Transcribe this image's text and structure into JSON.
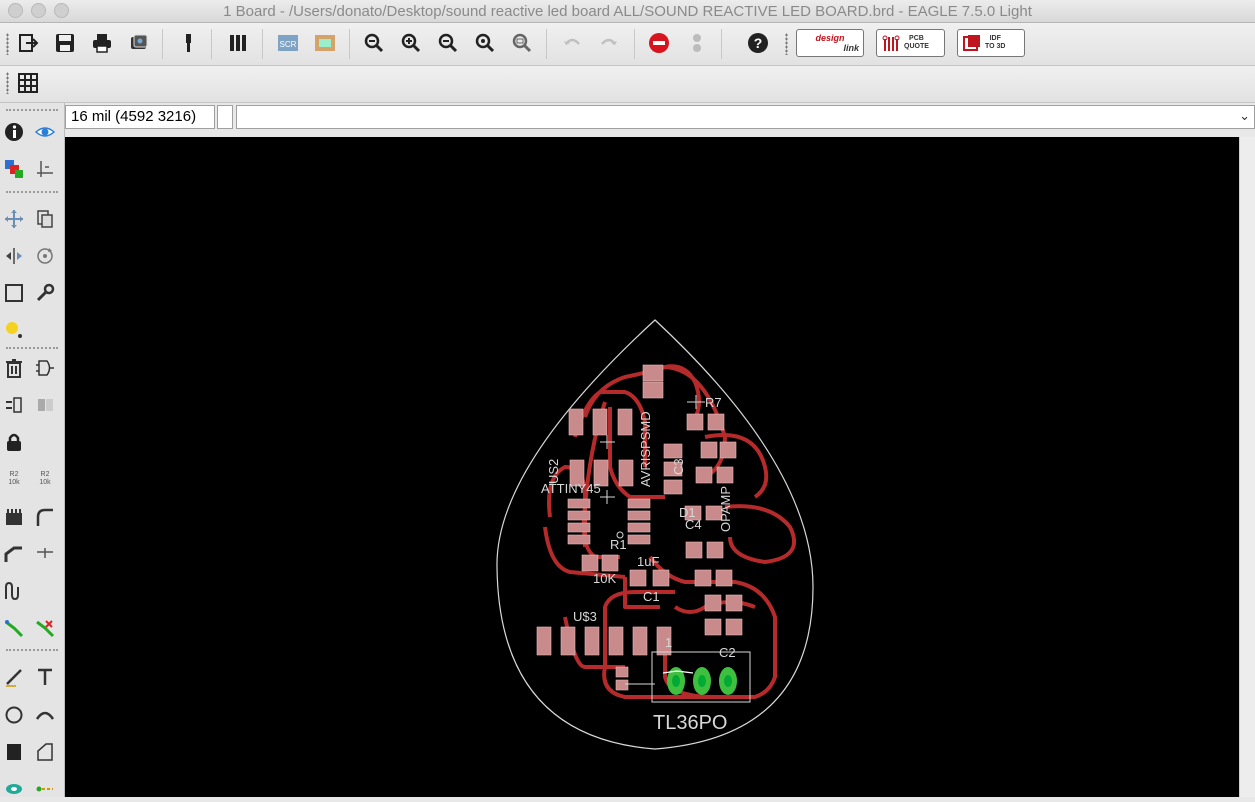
{
  "window": {
    "title": "1 Board - /Users/donato/Desktop/sound reactive led board ALL/SOUND REACTIVE LED BOARD.brd - EAGLE 7.5.0 Light"
  },
  "toolbar": {
    "design_link_top": "design",
    "design_link_bottom": "link",
    "pcb_quote_top": "PCB",
    "pcb_quote_bottom": "QUOTE",
    "idf_top": "IDF",
    "idf_bottom": "TO 3D",
    "script_label": "SCR"
  },
  "status": {
    "coordinates": "16 mil (4592 3216)",
    "command": ""
  },
  "left_tools": {
    "value_label_1": "R2",
    "value_label_1b": "10k",
    "value_label_2": "R2",
    "value_label_2b": "10k"
  },
  "board": {
    "labels": {
      "attiny": "ATTINY45",
      "avrisp": "AVRISPSMD",
      "opamp": "OPAMP",
      "us2": "US2",
      "us3": "U$3",
      "r1_value": "10K",
      "c1_value": "1uF",
      "c1_name": "C1",
      "c2_name": "C2",
      "c3_name": "C3",
      "c4_name": "C4",
      "r7_name": "R7",
      "r1_name": "R1",
      "d1_name": "D1",
      "regulator": "TL36PO",
      "j1": "1"
    }
  },
  "colors": {
    "canvas": "#000000",
    "trace": "#b52a2a",
    "pad": "#c88a8a",
    "outline": "#d8d8d8",
    "via": "#3fbf3f"
  }
}
